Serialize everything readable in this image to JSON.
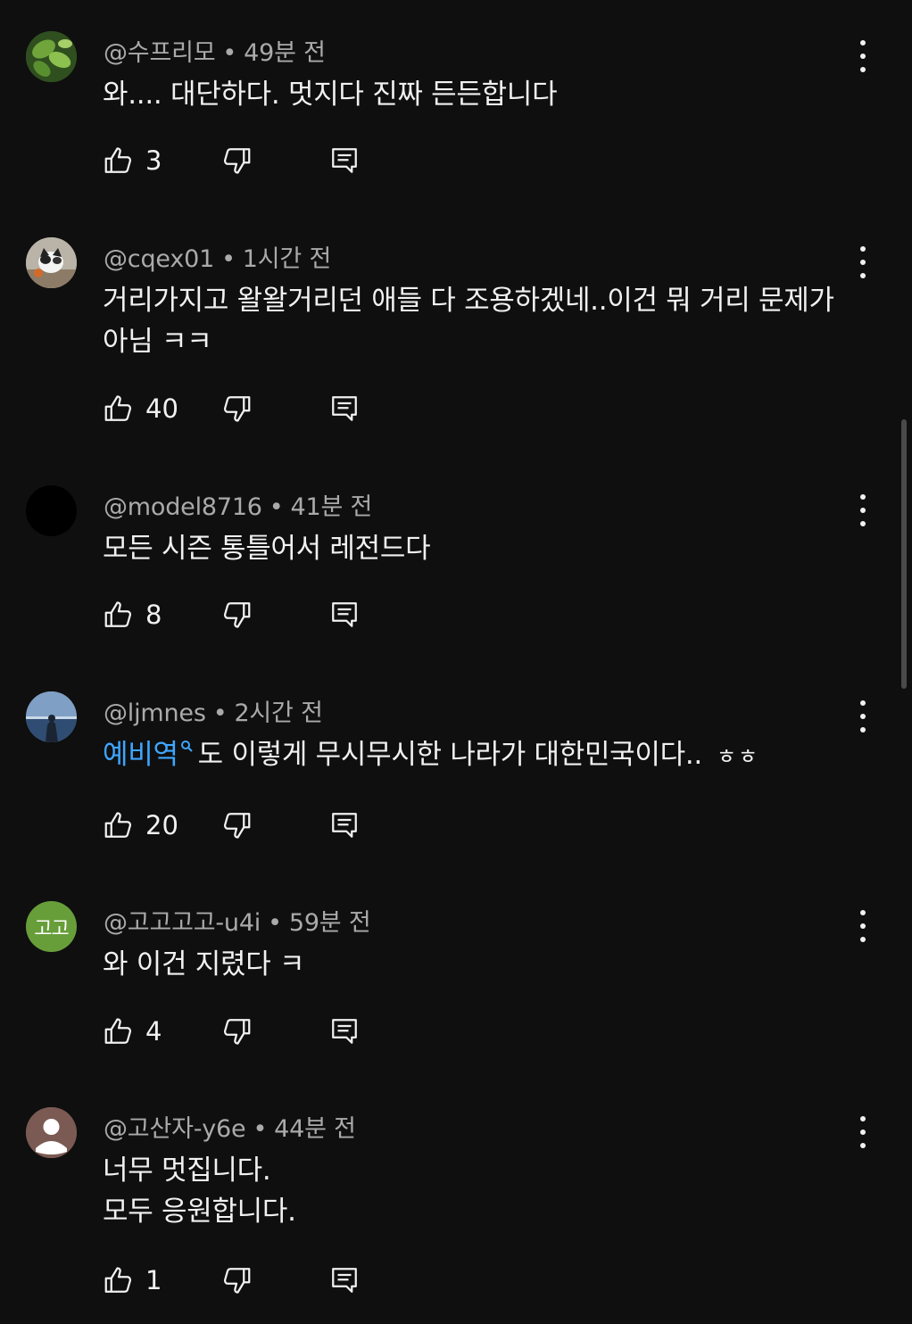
{
  "comments": [
    {
      "handle": "@수프리모",
      "time": "49분 전",
      "avatar": {
        "kind": "leaf-photo",
        "color": "#4c7a2c"
      },
      "lines": [
        "와.... 대단하다. 멋지다 진짜 든든합니다"
      ],
      "likes": "3"
    },
    {
      "handle": "@cqex01",
      "time": "1시간 전",
      "avatar": {
        "kind": "cat-photo",
        "color": "#8a8a8a"
      },
      "lines": [
        "거리가지고 왈왈거리던 애들 다 조용하겠네..이건 뭐 거리 문제가",
        "아님 ㅋㅋ"
      ],
      "likes": "40"
    },
    {
      "handle": "@model8716",
      "time": "41분 전",
      "avatar": {
        "kind": "black",
        "color": "#000000"
      },
      "lines": [
        "모든 시즌 통틀어서 레전드다"
      ],
      "likes": "8"
    },
    {
      "handle": "@ljmnes",
      "time": "2시간 전",
      "avatar": {
        "kind": "sky-photo",
        "color": "#5d7fa6"
      },
      "hashtag": "예비역",
      "lines": [
        "도 이렇게 무시무시한 나라가 대한민국이다.."
      ],
      "suffix": "ㅎㅎ",
      "likes": "20"
    },
    {
      "handle": "@고고고고-u4i",
      "time": "59분 전",
      "avatar": {
        "kind": "text",
        "text": "고고",
        "color": "#679e3a"
      },
      "lines": [
        "와 이건 지렸다 ㅋ"
      ],
      "likes": "4"
    },
    {
      "handle": "@고산자-y6e",
      "time": "44분 전",
      "avatar": {
        "kind": "default-person",
        "color": "#7a5a52"
      },
      "lines": [
        "너무 멋집니다.",
        "모두 응원합니다."
      ],
      "likes": "1"
    }
  ],
  "icons": {
    "like": "thumb-up-icon",
    "dislike": "thumb-down-icon",
    "reply": "reply-comment-icon",
    "more": "more-vert-icon"
  }
}
